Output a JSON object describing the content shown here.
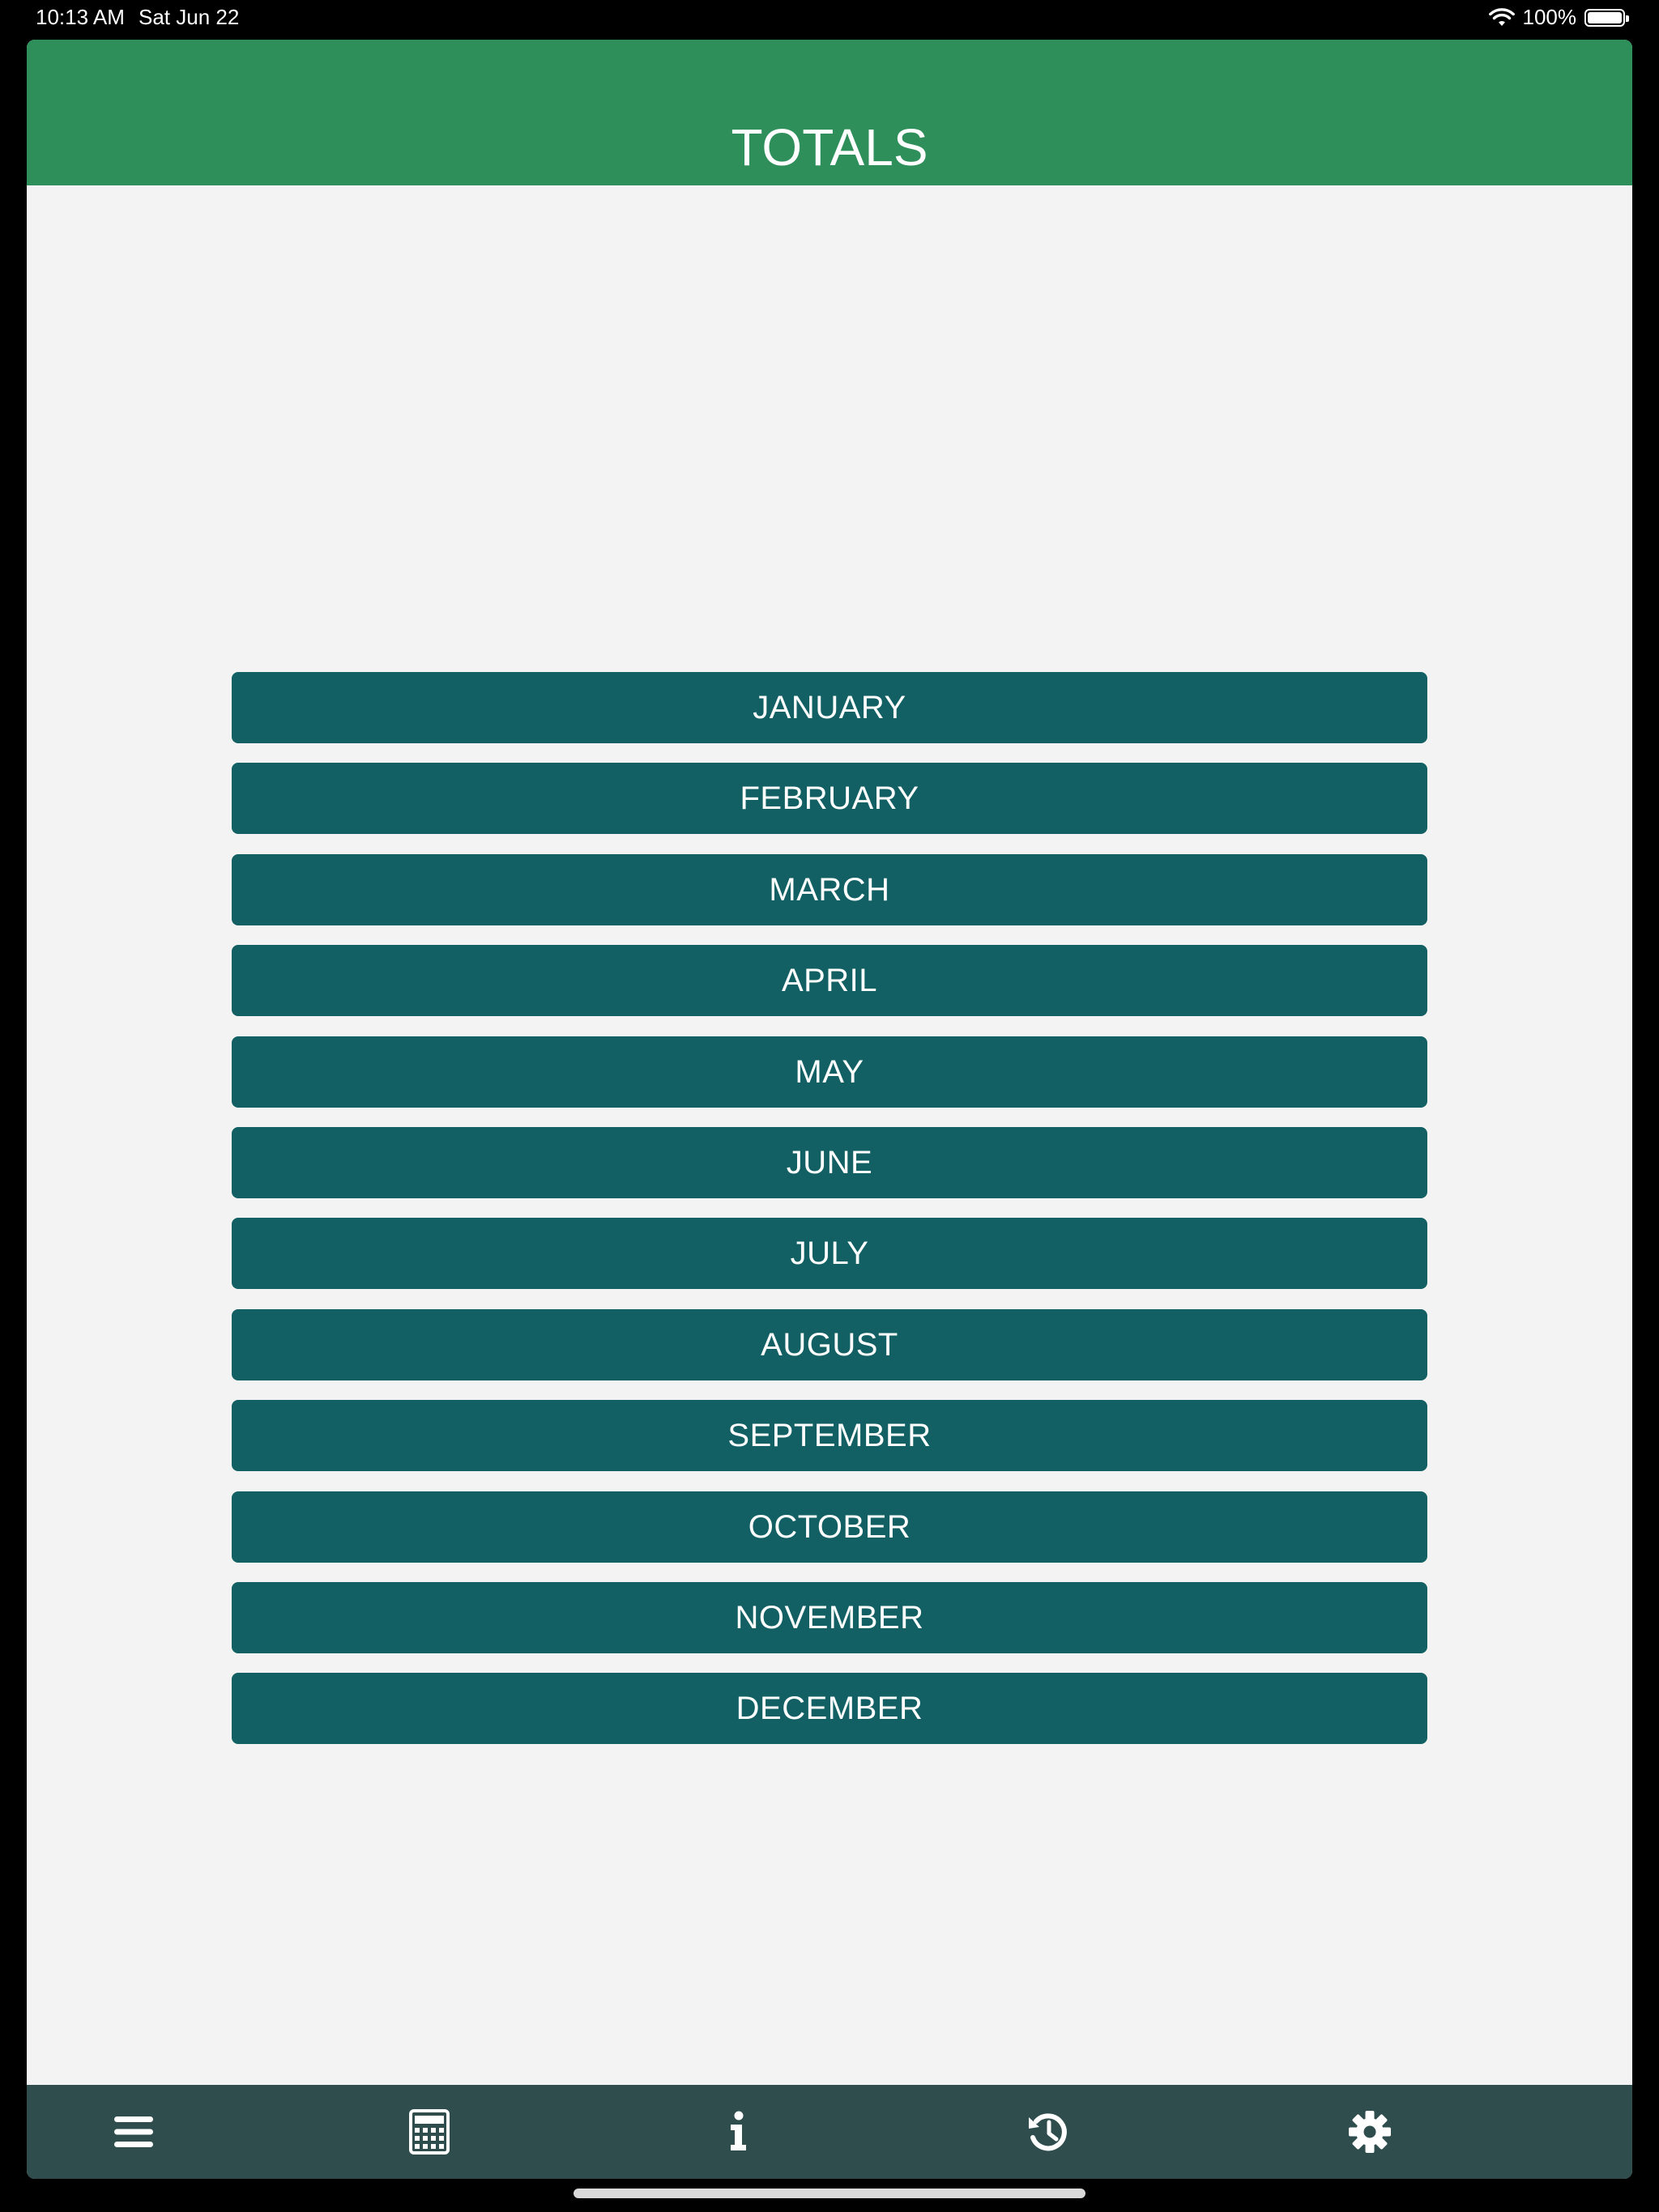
{
  "status_bar": {
    "time": "10:13 AM",
    "date": "Sat Jun 22",
    "battery_percent": "100%",
    "battery_level": 1.0
  },
  "header": {
    "title": "TOTALS",
    "color": "#2e8f5a"
  },
  "months": [
    {
      "label": "JANUARY"
    },
    {
      "label": "FEBRUARY"
    },
    {
      "label": "MARCH"
    },
    {
      "label": "APRIL"
    },
    {
      "label": "MAY"
    },
    {
      "label": "JUNE"
    },
    {
      "label": "JULY"
    },
    {
      "label": "AUGUST"
    },
    {
      "label": "SEPTEMBER"
    },
    {
      "label": "OCTOBER"
    },
    {
      "label": "NOVEMBER"
    },
    {
      "label": "DECEMBER"
    }
  ],
  "month_button_color": "#126063",
  "tab_bar": {
    "color": "#2f4d4d",
    "items": [
      {
        "icon": "menu-icon"
      },
      {
        "icon": "calculator-icon"
      },
      {
        "icon": "info-icon"
      },
      {
        "icon": "history-icon"
      },
      {
        "icon": "gear-icon"
      }
    ]
  }
}
